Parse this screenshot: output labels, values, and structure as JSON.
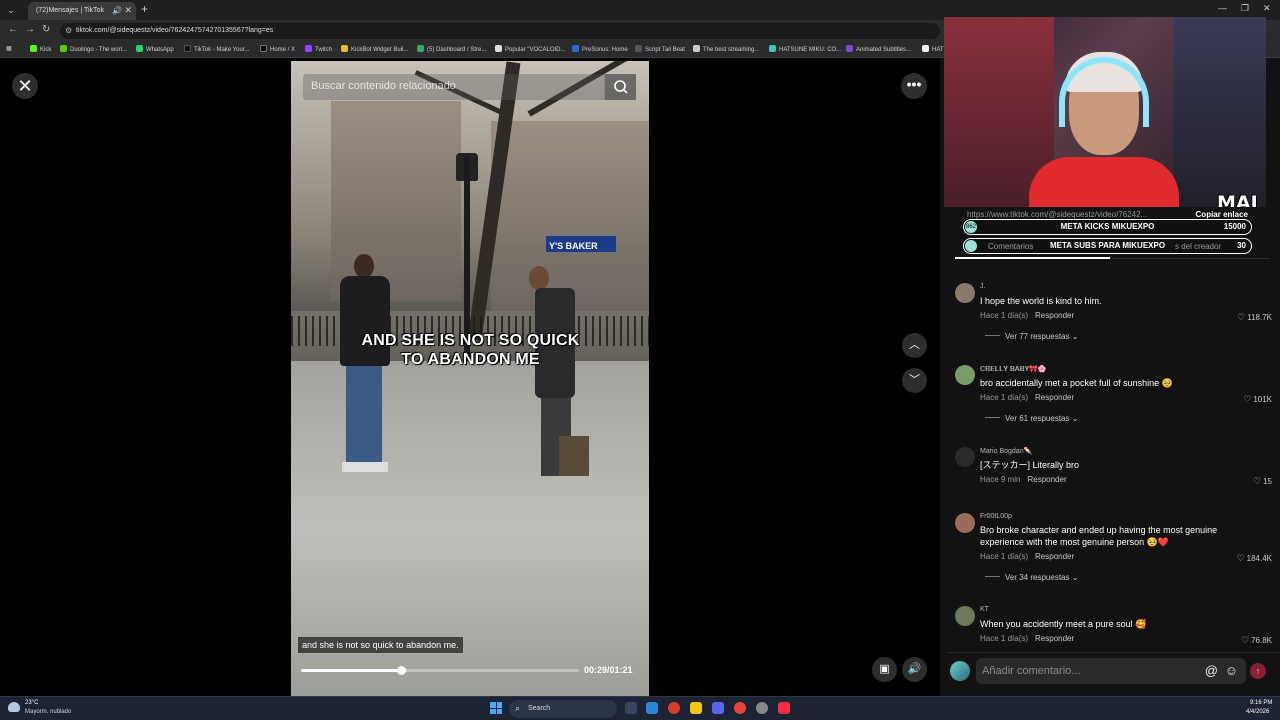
{
  "browser": {
    "tab_title": "(72)Mensajes | TikTok",
    "url": "tiktok.com/@sidequestz/video/7624247574270135567?lang=es",
    "bookmarks": [
      "Kick",
      "Duolingo - The worl...",
      "WhatsApp",
      "TikTok - Make Your...",
      "Home / X",
      "Twitch",
      "KickBot Widget Buil...",
      "(5) Dashboard / Stre...",
      "Popular \"VOCALOID...",
      "PreSonus: Home",
      "Script Tail Beat",
      "The best streaming...",
      "HATSUNE MIKU: CO...",
      "Animated Subtitles...",
      "HAT"
    ]
  },
  "video": {
    "search_placeholder": "Buscar contenido relacionado",
    "caption_line1": "AND SHE IS NOT SO QUICK",
    "caption_line2": "TO ABANDON ME",
    "subtitle": "and she is not so quick to abandon me.",
    "timecode": "00:29/01:21",
    "progress_fraction": 0.36,
    "shop_sign": "Y'S BAKER"
  },
  "stream_overlay": {
    "brand": "MAI",
    "share_url": "https://www.tiktok.com/@sidequestz/video/76242...",
    "copy_link": "Copiar enlace",
    "goals": [
      {
        "label": "META KICKS MIKUEXPO",
        "value": "15000",
        "knob": "862"
      },
      {
        "label": "META SUBS PARA MIKUEXPO",
        "value": "30",
        "knob": ""
      }
    ],
    "tab_comments": "Comentarios",
    "tab_creator": "s del creador"
  },
  "comments": [
    {
      "user": "J.",
      "text": "I hope the world is kind to him.",
      "time": "Hace 1 día(s)",
      "reply": "Responder",
      "likes": "118.7K",
      "replies": "Ver 77 respuestas",
      "avatar": "#8a7a6a"
    },
    {
      "user": "𝐂𝐑𝐄𝐋𝐋𝐘 𝐁𝐀𝐁𝐘🎀🌸",
      "text": "bro accidentally met a pocket full of sunshine 🥹",
      "time": "Hace 1 día(s)",
      "reply": "Responder",
      "likes": "101K",
      "replies": "Ver 61 respuestas",
      "avatar": "#7a9a6a"
    },
    {
      "user": "Mario Bogdan🍡",
      "text": "[ステッカー] Literally bro",
      "time": "Hace 9 min",
      "reply": "Responder",
      "likes": "15",
      "replies": "",
      "avatar": "#2a2a2a"
    },
    {
      "user": "Fr00tL00p",
      "text": "Bro broke character and ended up having the most genuine experience with the most genuine person 🥹❤️",
      "time": "Hace 1 día(s)",
      "reply": "Responder",
      "likes": "184.4K",
      "replies": "Ver 34 respuestas",
      "avatar": "#9a6a5a"
    },
    {
      "user": "KT",
      "text": "When you accidently meet a pure soul 🥰",
      "time": "Hace 1 día(s)",
      "reply": "Responder",
      "likes": "76.8K",
      "replies": "",
      "avatar": "#6a7a5a"
    }
  ],
  "add_comment": {
    "placeholder": "Añadir comentario..."
  },
  "taskbar": {
    "temp": "23°C",
    "weather": "Mayorm. nublado",
    "search": "Search",
    "time": "9:16 PM",
    "date": "4/4/2026"
  },
  "colors": {
    "accent": "#fe2c55",
    "panel_bg": "#121212",
    "taskbar_bg": "#1c2333"
  }
}
